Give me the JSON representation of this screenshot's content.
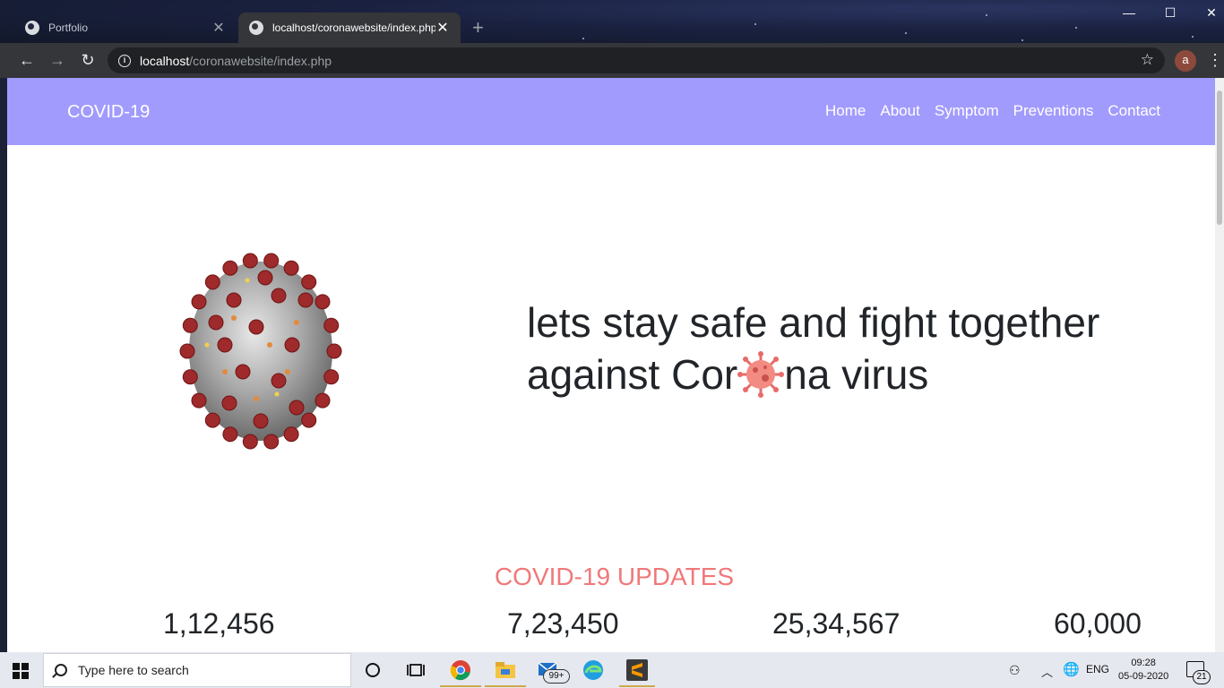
{
  "browser": {
    "tabs": [
      {
        "title": "Portfolio",
        "active": false
      },
      {
        "title": "localhost/coronawebsite/index.php",
        "active": true
      }
    ],
    "address": {
      "host": "localhost",
      "path": "/coronawebsite/index.php"
    },
    "profile_initial": "a"
  },
  "site": {
    "brand": "COVID-19",
    "nav": [
      "Home",
      "About",
      "Symptom",
      "Preventions",
      "Contact"
    ],
    "hero": {
      "line1": "lets stay safe and fight together",
      "line2_pre": "against Cor",
      "line2_post": "na virus"
    },
    "updates_title": "COVID-19 UPDATES",
    "stats": [
      "1,12,456",
      "7,23,450",
      "25,34,567",
      "60,000"
    ],
    "colors": {
      "nav_bg": "#a29bfe",
      "updates_title": "#f0787a"
    }
  },
  "taskbar": {
    "search_placeholder": "Type here to search",
    "mail_badge": "99+",
    "language": "ENG",
    "time": "09:28",
    "date": "05-09-2020",
    "notifications": "21"
  }
}
